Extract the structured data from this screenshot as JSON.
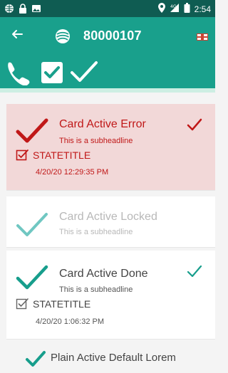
{
  "status_bar": {
    "time": "2:54",
    "icons": [
      "globe-icon",
      "lock-icon",
      "image-icon",
      "location-icon",
      "signal-icon",
      "battery-icon"
    ]
  },
  "app_bar": {
    "title": "80000107",
    "back_icon": "arrow-left-icon",
    "logo_icon": "logo-icon",
    "language_icon": "uk-flag-icon"
  },
  "toolbar": {
    "icons": [
      "phone-icon",
      "checkbox-checked-icon",
      "check-icon"
    ]
  },
  "colors": {
    "status_bar": "#0f5c52",
    "primary": "#19a08c",
    "error_bg": "#f2d8d8",
    "error_text": "#c01818",
    "locked_check": "#70c7c2",
    "done_check": "#179e8c"
  },
  "cards": [
    {
      "state": "error",
      "title": "Card Active Error",
      "subtitle": "This is a subheadline",
      "state_title": "STATETITLE",
      "timestamp": "4/20/20 12:29:35 PM"
    },
    {
      "state": "locked",
      "title": "Card Active Locked",
      "subtitle": "This is a subheadline"
    },
    {
      "state": "done",
      "title": "Card Active Done",
      "subtitle": "This is a subheadline",
      "state_title": "STATETITLE",
      "timestamp": "4/20/20 1:06:32 PM"
    },
    {
      "state": "default",
      "title": "Plain Active Default Lorem"
    }
  ]
}
